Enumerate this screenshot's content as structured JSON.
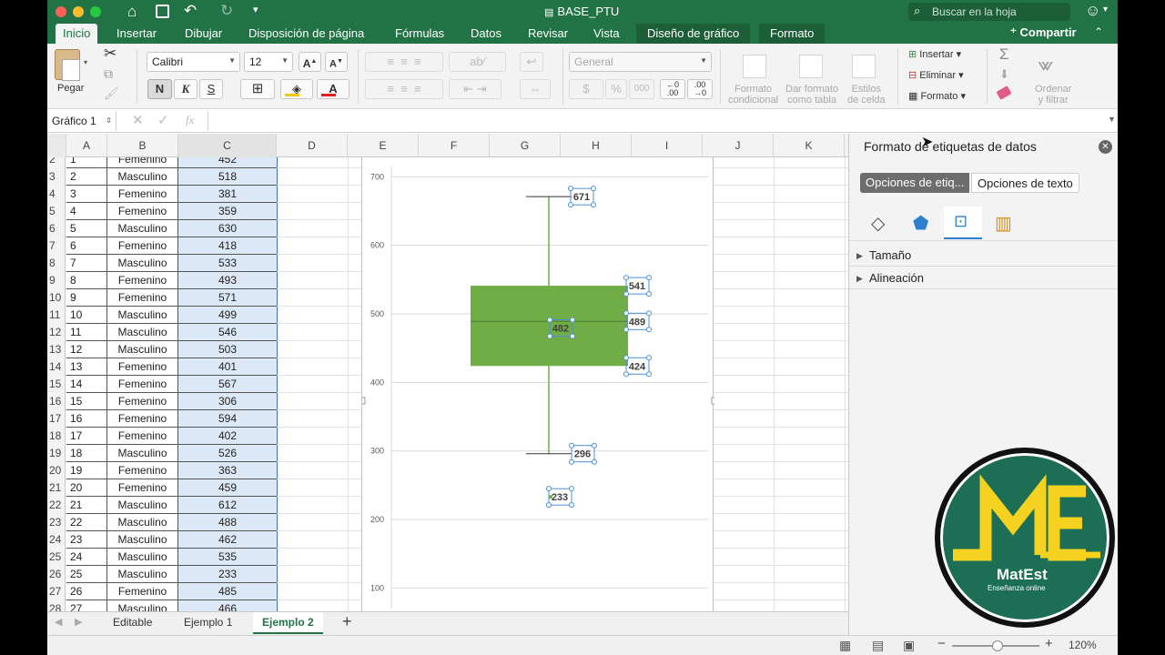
{
  "window": {
    "title": "BASE_PTU",
    "search_placeholder": "Buscar en la hoja"
  },
  "tabs": [
    "Inicio",
    "Insertar",
    "Dibujar",
    "Disposición de página",
    "Fórmulas",
    "Datos",
    "Revisar",
    "Vista",
    "Diseño de gráfico",
    "Formato"
  ],
  "share_label": "Compartir",
  "ribbon": {
    "paste": "Pegar",
    "font": "Calibri",
    "size": "12",
    "bold": "N",
    "italic": "K",
    "underline": "S",
    "number_format": "General",
    "cond_format": "Formato\ncondicional",
    "table_format": "Dar formato\ncomo tabla",
    "cell_styles": "Estilos\nde celda",
    "insert": "Insertar",
    "delete": "Eliminar",
    "format": "Formato",
    "sort": "Ordenar\ny filtrar",
    "currency": "$",
    "percent": "%",
    "thousands": "000"
  },
  "formula_bar": {
    "name_box": "Gráfico 1",
    "fx": "fx"
  },
  "columns": [
    "A",
    "B",
    "C",
    "D",
    "E",
    "F",
    "G",
    "H",
    "I",
    "J",
    "K"
  ],
  "rows": [
    {
      "n": "2",
      "a": "1",
      "b": "Femenino",
      "c": "452"
    },
    {
      "n": "3",
      "a": "2",
      "b": "Masculino",
      "c": "518"
    },
    {
      "n": "4",
      "a": "3",
      "b": "Femenino",
      "c": "381"
    },
    {
      "n": "5",
      "a": "4",
      "b": "Femenino",
      "c": "359"
    },
    {
      "n": "6",
      "a": "5",
      "b": "Masculino",
      "c": "630"
    },
    {
      "n": "7",
      "a": "6",
      "b": "Femenino",
      "c": "418"
    },
    {
      "n": "8",
      "a": "7",
      "b": "Masculino",
      "c": "533"
    },
    {
      "n": "9",
      "a": "8",
      "b": "Femenino",
      "c": "493"
    },
    {
      "n": "10",
      "a": "9",
      "b": "Femenino",
      "c": "571"
    },
    {
      "n": "11",
      "a": "10",
      "b": "Masculino",
      "c": "499"
    },
    {
      "n": "12",
      "a": "11",
      "b": "Masculino",
      "c": "546"
    },
    {
      "n": "13",
      "a": "12",
      "b": "Masculino",
      "c": "503"
    },
    {
      "n": "14",
      "a": "13",
      "b": "Femenino",
      "c": "401"
    },
    {
      "n": "15",
      "a": "14",
      "b": "Femenino",
      "c": "567"
    },
    {
      "n": "16",
      "a": "15",
      "b": "Femenino",
      "c": "306"
    },
    {
      "n": "17",
      "a": "16",
      "b": "Femenino",
      "c": "594"
    },
    {
      "n": "18",
      "a": "17",
      "b": "Femenino",
      "c": "402"
    },
    {
      "n": "19",
      "a": "18",
      "b": "Masculino",
      "c": "526"
    },
    {
      "n": "20",
      "a": "19",
      "b": "Femenino",
      "c": "363"
    },
    {
      "n": "21",
      "a": "20",
      "b": "Femenino",
      "c": "459"
    },
    {
      "n": "22",
      "a": "21",
      "b": "Masculino",
      "c": "612"
    },
    {
      "n": "23",
      "a": "22",
      "b": "Masculino",
      "c": "488"
    },
    {
      "n": "24",
      "a": "23",
      "b": "Masculino",
      "c": "462"
    },
    {
      "n": "25",
      "a": "24",
      "b": "Masculino",
      "c": "535"
    },
    {
      "n": "26",
      "a": "25",
      "b": "Masculino",
      "c": "233"
    },
    {
      "n": "27",
      "a": "26",
      "b": "Femenino",
      "c": "485"
    },
    {
      "n": "28",
      "a": "27",
      "b": "Masculino",
      "c": "466"
    }
  ],
  "chart_data": {
    "type": "box",
    "yticks": [
      100,
      200,
      300,
      400,
      500,
      600,
      700
    ],
    "ylim": [
      70,
      715
    ],
    "box": {
      "min": 296,
      "q1": 424,
      "median": 489,
      "mean": 482,
      "q3": 541,
      "max": 671,
      "outlier": 233
    },
    "labels": [
      "671",
      "541",
      "489",
      "482",
      "424",
      "296",
      "233"
    ],
    "box_color": "#70ad47"
  },
  "pane": {
    "title": "Formato de etiquetas de datos",
    "tab_label_options": "Opciones de etiq...",
    "tab_text_options": "Opciones de texto",
    "sections": [
      "Tamaño",
      "Alineación"
    ]
  },
  "sheets": [
    "Editable",
    "Ejemplo 1",
    "Ejemplo 2"
  ],
  "zoom": "120%",
  "logo": {
    "letters": "ME",
    "name": "MatEst",
    "tagline": "Enseñanza online",
    "bg": "#1c6e55",
    "accent": "#f4d21f"
  }
}
